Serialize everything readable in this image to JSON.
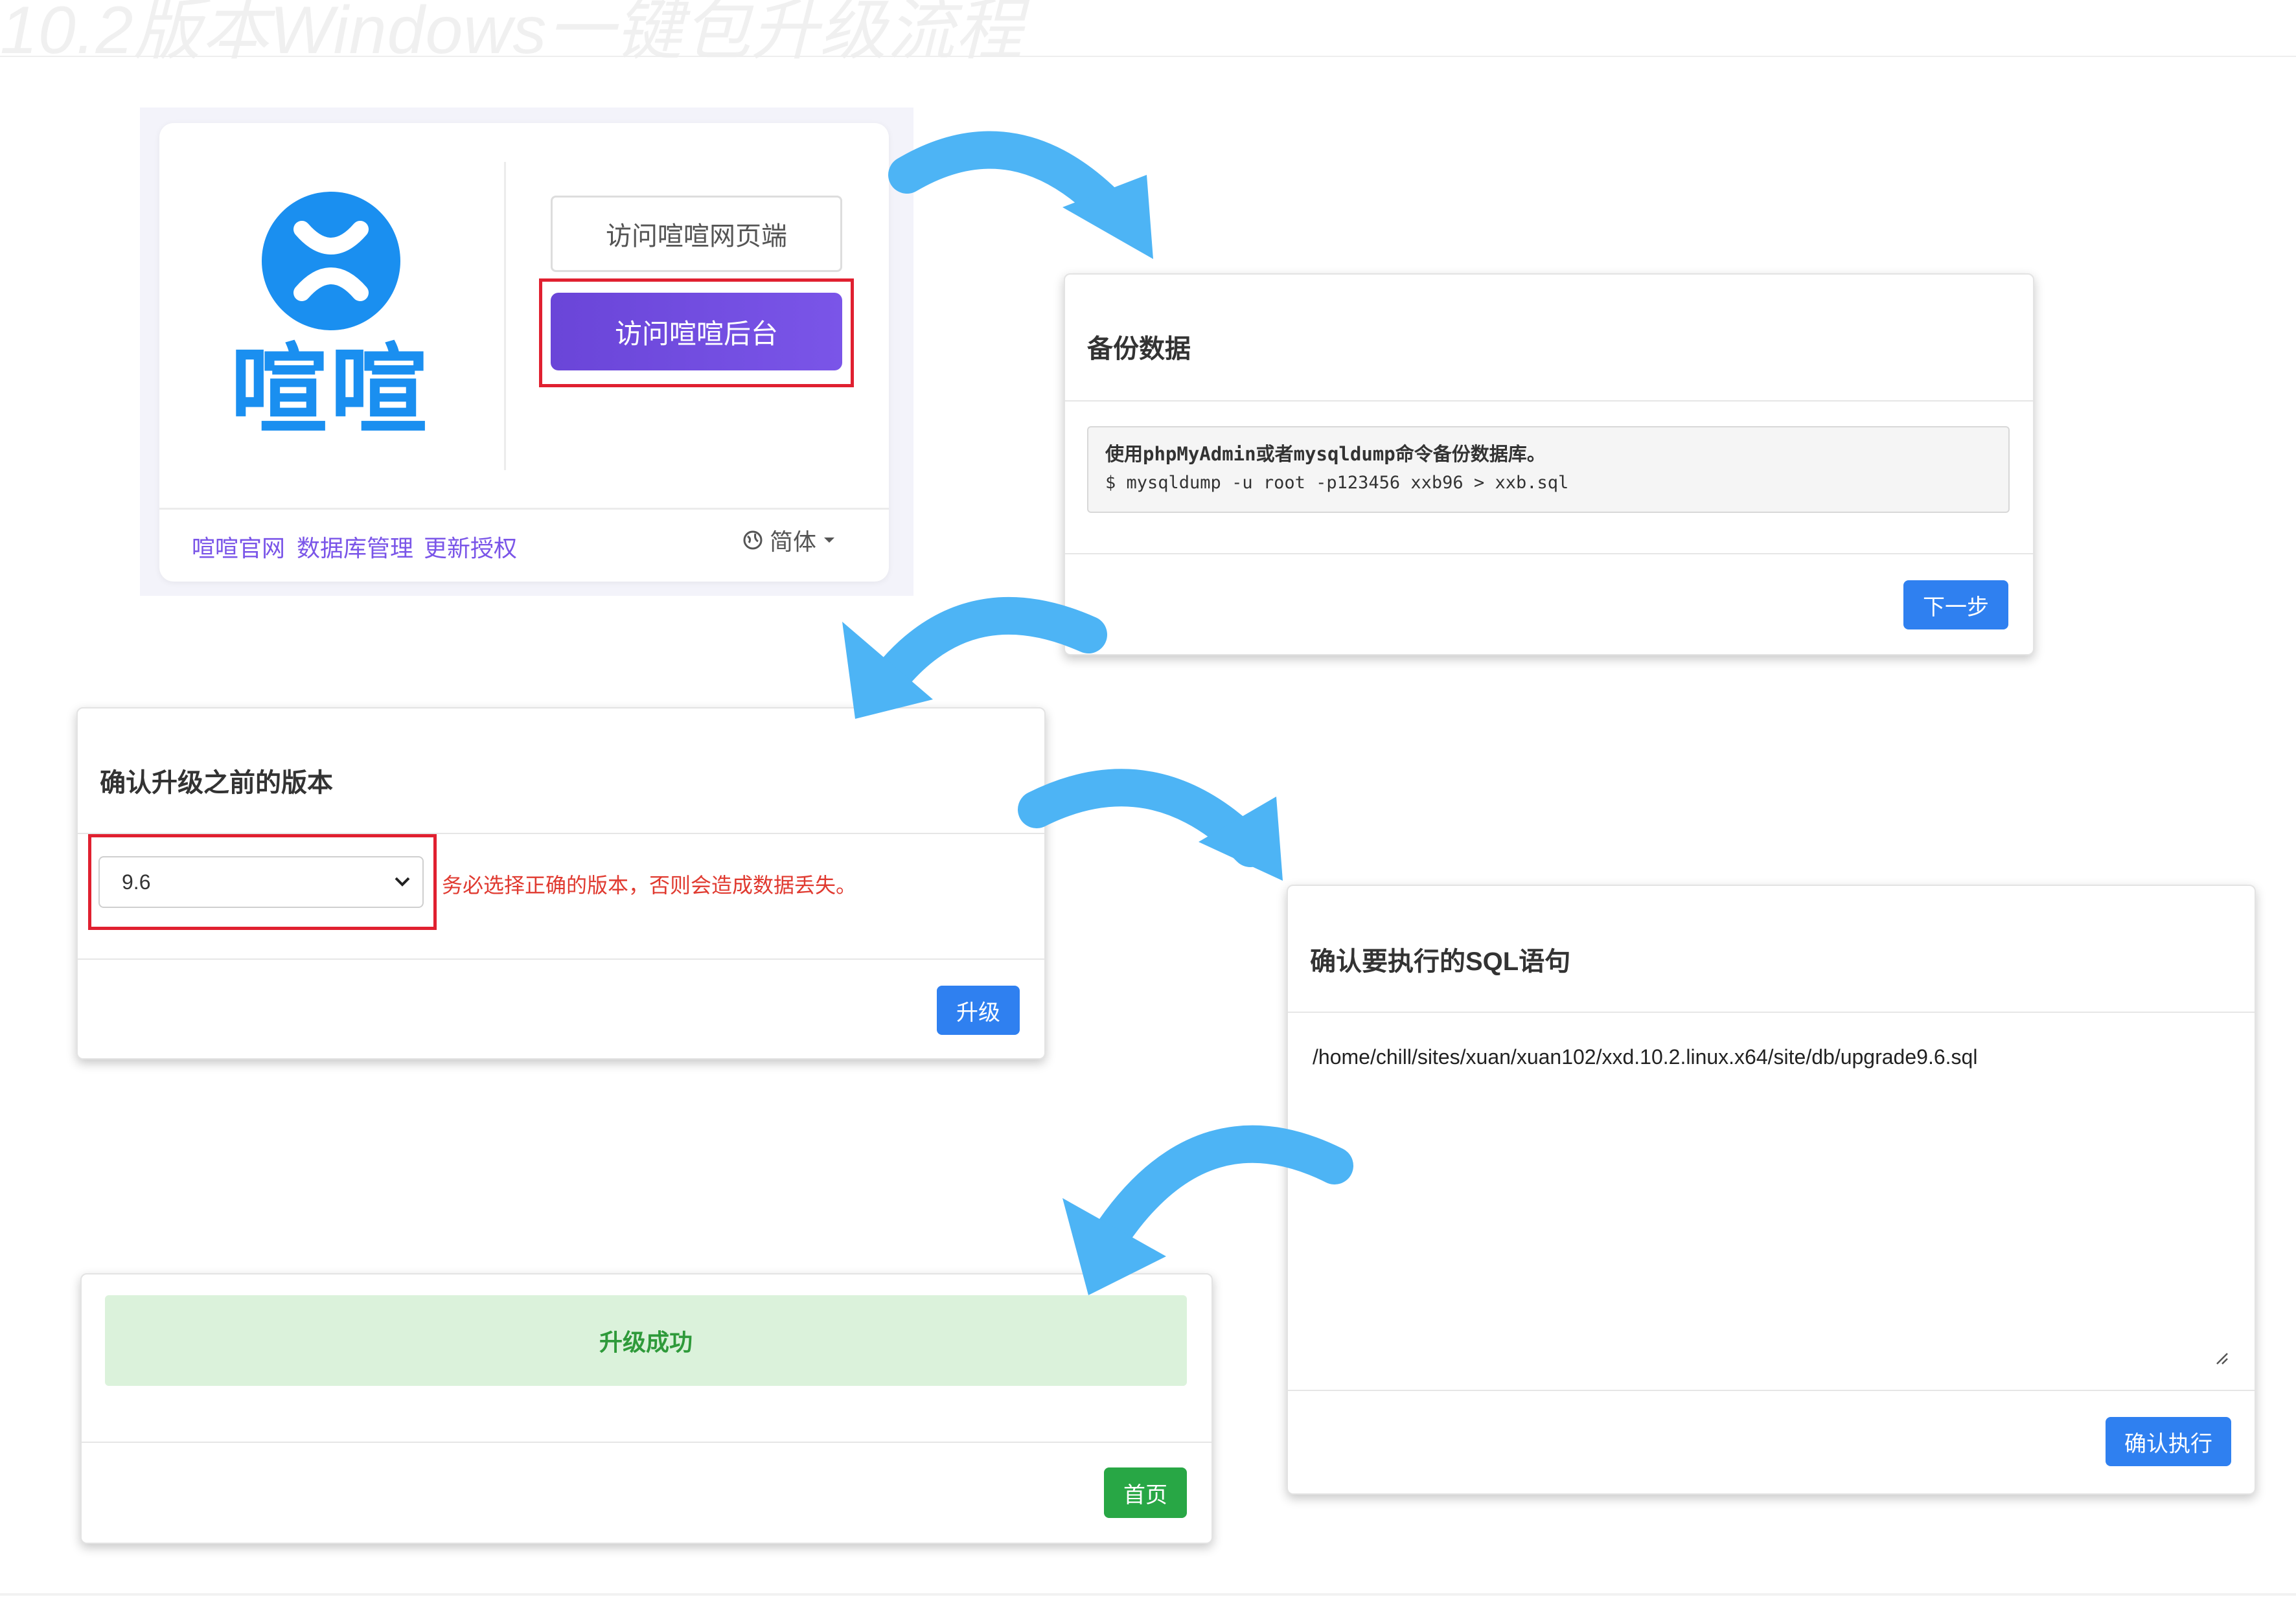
{
  "page": {
    "title": "10.2版本Windows一键包升级流程"
  },
  "login_panel": {
    "logo_text": "喧喧",
    "visit_web_label": "访问喧喧网页端",
    "visit_admin_label": "访问喧喧后台",
    "footer_links": [
      "喧喧官网",
      "数据库管理",
      "更新授权"
    ],
    "language": "简体"
  },
  "backup_panel": {
    "title": "备份数据",
    "instruction": "使用phpMyAdmin或者mysqldump命令备份数据库。",
    "command": "$ mysqldump -u root -p123456 xxb96 > xxb.sql",
    "next_label": "下一步"
  },
  "version_panel": {
    "title": "确认升级之前的版本",
    "selected_version": "9.6",
    "warning": "务必选择正确的版本，否则会造成数据丢失。",
    "upgrade_label": "升级"
  },
  "sql_panel": {
    "title": "确认要执行的SQL语句",
    "sql_path": "/home/chill/sites/xuan/xuan102/xxd.10.2.linux.x64/site/db/upgrade9.6.sql",
    "confirm_label": "确认执行"
  },
  "success_panel": {
    "message": "升级成功",
    "home_label": "首页"
  },
  "colors": {
    "arrow": "#4db4f5",
    "primary_blue": "#2f80f0",
    "purple": "#7a55e8",
    "highlight_red": "#e02030",
    "success_green": "#28a745"
  }
}
